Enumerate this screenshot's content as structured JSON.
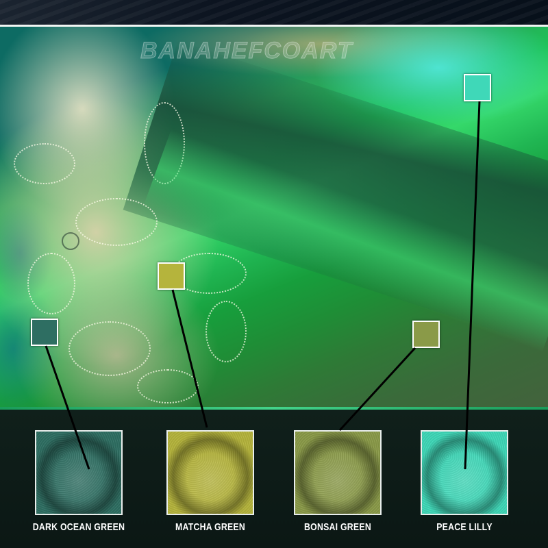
{
  "watermark": "BANAHEFCOART",
  "colors": {
    "dark_ocean_green": "#2e6e62",
    "matcha_green": "#b5b43c",
    "bonsai_green": "#8a9a48",
    "peace_lilly": "#3fd8b8"
  },
  "swatches": [
    {
      "label": "DARK OCEAN GREEN",
      "color_key": "dark_ocean_green"
    },
    {
      "label": "MATCHA GREEN",
      "color_key": "matcha_green"
    },
    {
      "label": "BONSAI GREEN",
      "color_key": "bonsai_green"
    },
    {
      "label": "PEACE LILLY",
      "color_key": "peace_lilly"
    }
  ]
}
